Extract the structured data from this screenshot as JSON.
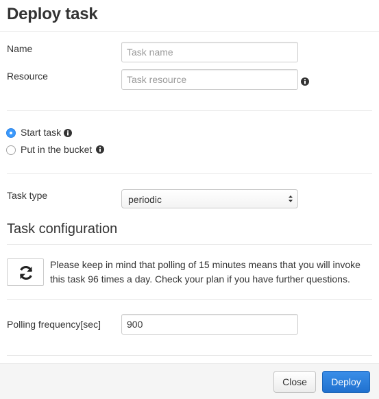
{
  "dialog": {
    "title": "Deploy task"
  },
  "form": {
    "name": {
      "label": "Name",
      "placeholder": "Task name",
      "value": ""
    },
    "resource": {
      "label": "Resource",
      "placeholder": "Task resource",
      "value": "",
      "info_icon": "info-circle-icon"
    },
    "mode": {
      "options": [
        {
          "label": "Start task",
          "checked": true,
          "info_icon": "info-circle-icon"
        },
        {
          "label": "Put in the bucket",
          "checked": false,
          "info_icon": "info-circle-icon"
        }
      ]
    },
    "task_type": {
      "label": "Task type",
      "selected": "periodic",
      "icon": "select-arrows-icon"
    }
  },
  "configuration": {
    "title": "Task configuration",
    "notice_icon": "refresh-icon",
    "notice": "Please keep in mind that polling of 15 minutes means that you will invoke this task 96 times a day. Check your plan if you have further questions.",
    "polling": {
      "label": "Polling frequency[sec]",
      "value": "900"
    }
  },
  "footer": {
    "close_label": "Close",
    "deploy_label": "Deploy"
  },
  "colors": {
    "accent": "#2071cf",
    "radio_checked": "#3b99fc"
  }
}
